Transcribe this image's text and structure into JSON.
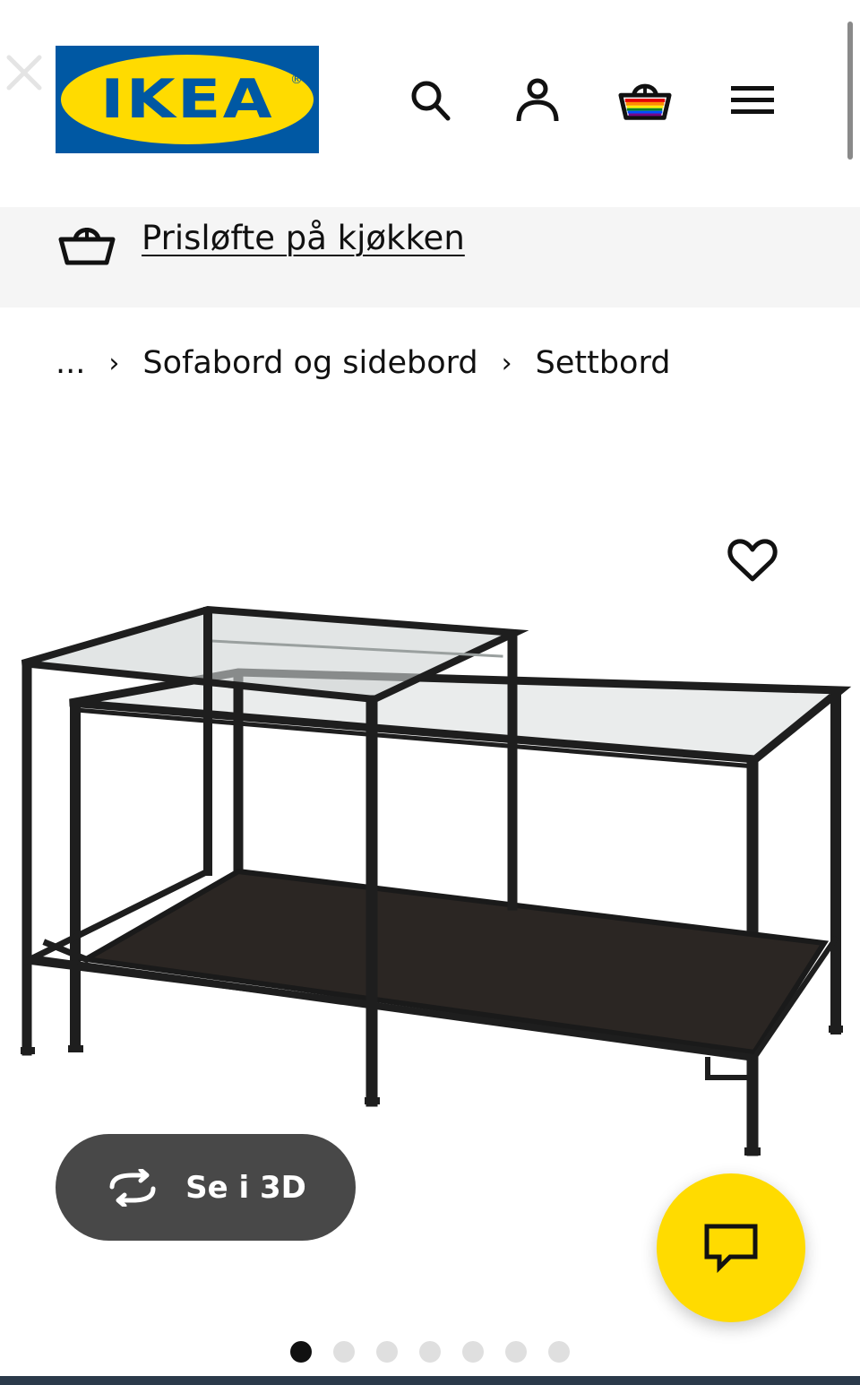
{
  "header": {
    "logo": {
      "text": "IKEA",
      "reg_mark": "®",
      "blue": "#0058a3",
      "yellow": "#ffdb00"
    },
    "icons": [
      "close-icon",
      "search-icon",
      "user-icon",
      "basket-icon",
      "menu-icon"
    ]
  },
  "promo": {
    "icon": "basket-icon",
    "link_label": "Prisløfte på kjøkken"
  },
  "breadcrumb": {
    "ellipsis": "...",
    "separator": "›",
    "items": [
      "Sofabord og sidebord",
      "Settbord"
    ]
  },
  "product": {
    "favorite_icon": "heart-icon",
    "view_3d": {
      "icon": "rotate-icon",
      "label": "Se i 3D"
    }
  },
  "chat": {
    "icon": "chat-icon"
  },
  "carousel": {
    "total": 7,
    "active": 1
  },
  "colors": {
    "chat_bg": "#ffdb00",
    "btn3d_bg": "#484848",
    "promo_bg": "#f5f5f5"
  }
}
